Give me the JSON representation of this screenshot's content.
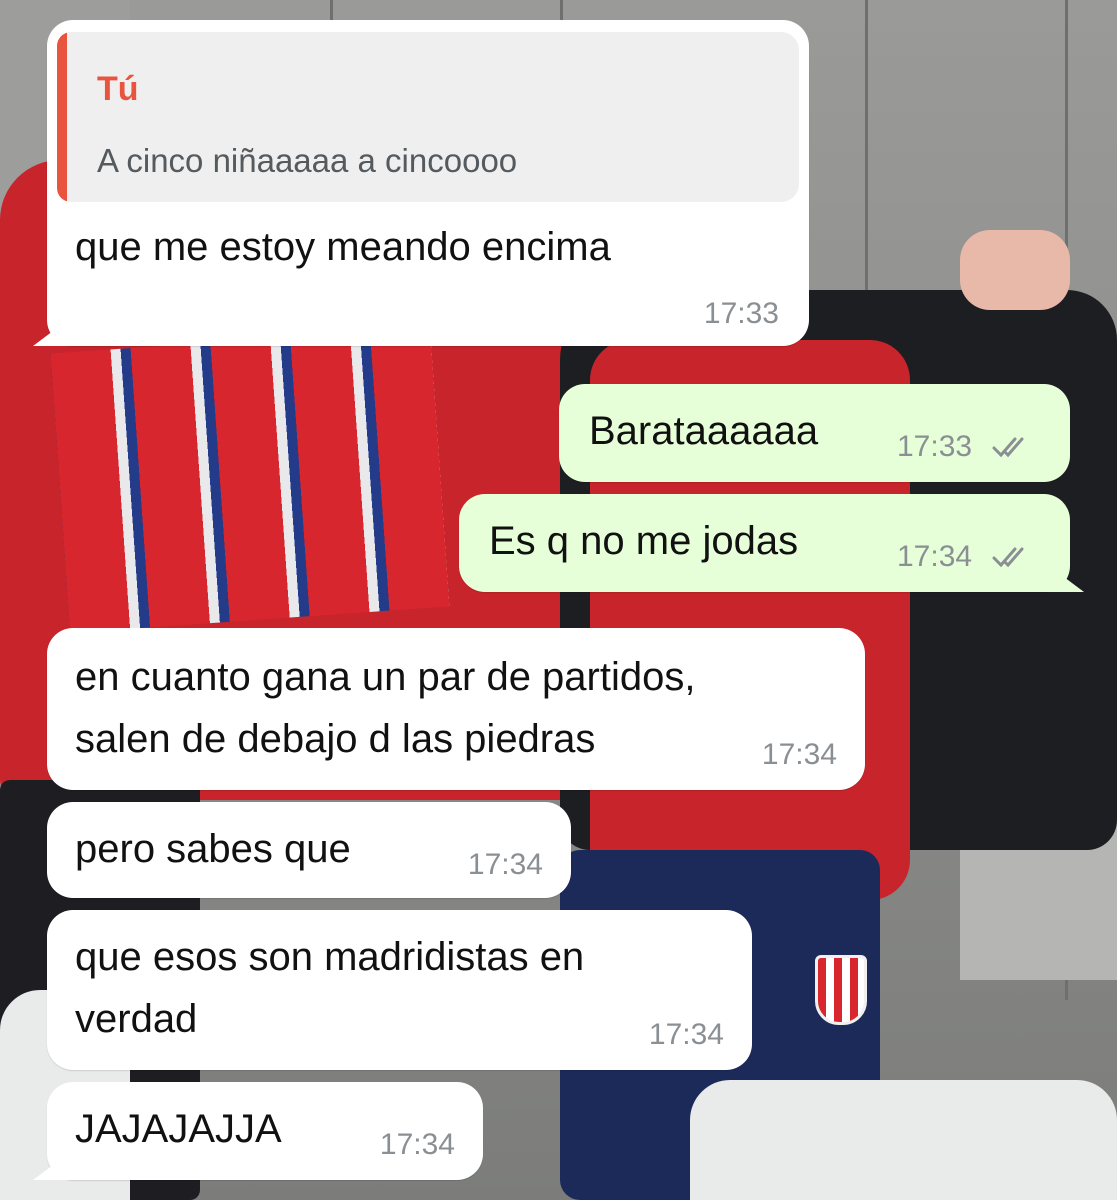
{
  "quote": {
    "author": "Tú",
    "text": "A cinco niñaaaaa a cincoooo"
  },
  "messages": [
    {
      "text": "que me estoy meando encima",
      "time": "17:33",
      "direction": "incoming"
    },
    {
      "text": "Baratаaaaaa",
      "time": "17:33",
      "direction": "outgoing",
      "status": "read-ticks-icon"
    },
    {
      "text": "Es q no me jodas",
      "time": "17:34",
      "direction": "outgoing",
      "status": "read-ticks-icon"
    },
    {
      "text": "en cuanto gana un par de partidos,\nsalen de debajo d las piedras",
      "time": "17:34",
      "direction": "incoming"
    },
    {
      "text": "pero sabes que",
      "time": "17:34",
      "direction": "incoming"
    },
    {
      "text": "que esos son madridistas en\nverdad",
      "time": "17:34",
      "direction": "incoming"
    },
    {
      "text": "JAJAJAJJA",
      "time": "17:34",
      "direction": "incoming"
    }
  ],
  "colors": {
    "incoming_bubble": "#ffffff",
    "outgoing_bubble": "#e7ffd9",
    "quote_accent": "#e8543d",
    "timestamp": "#8a8f93"
  }
}
